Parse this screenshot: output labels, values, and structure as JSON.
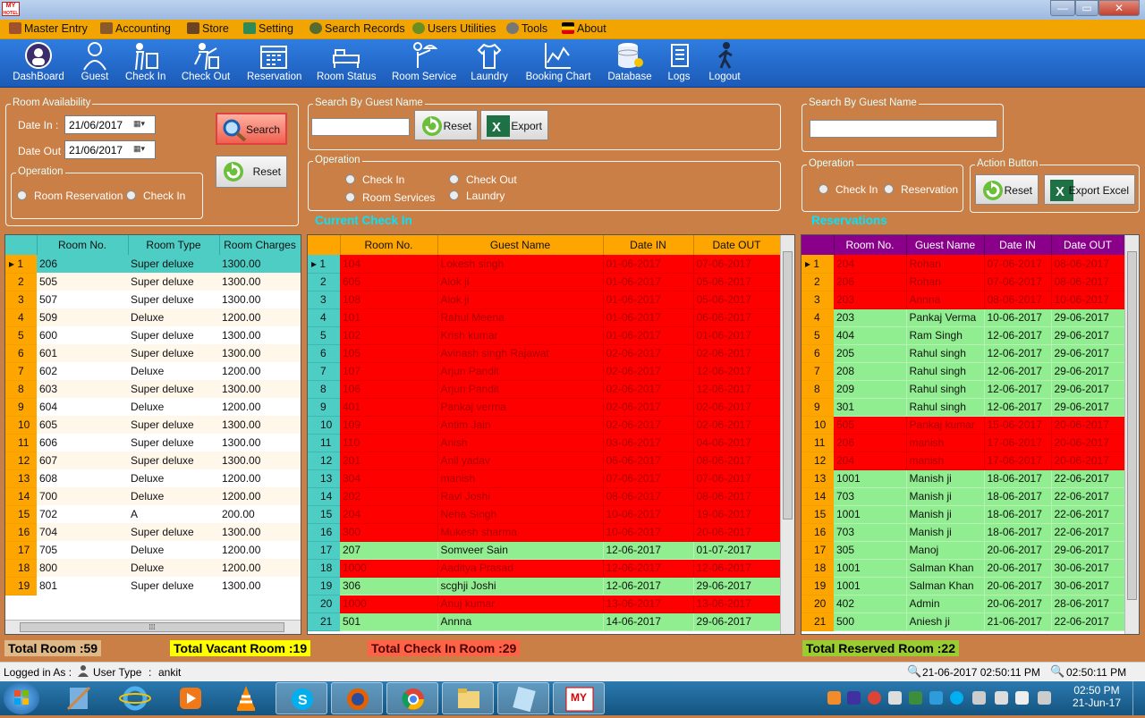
{
  "window": {
    "min": "—",
    "max": "▭",
    "close": "✕"
  },
  "appicon": {
    "line1": "MY",
    "line2": "HOTEL"
  },
  "menu": [
    "Master Entry",
    "Accounting",
    "Store",
    "Setting",
    "Search Records",
    "Users Utilities",
    "Tools",
    "About"
  ],
  "toolbar": [
    "DashBoard",
    "Guest",
    "Check In",
    "Check Out",
    "Reservation",
    "Room Status",
    "Room Service",
    "Laundry",
    "Booking Chart",
    "Database",
    "Logs",
    "Logout"
  ],
  "availability": {
    "legend": "Room Availability",
    "date_in_label": "Date In :",
    "date_in": "21/06/2017",
    "date_out_label": "Date Out :",
    "date_out": "21/06/2017",
    "operation_legend": "Operation",
    "radio1": "Room Reservation",
    "radio2": "Check In",
    "search_btn": "Search",
    "reset_btn": "Reset"
  },
  "checkin_search": {
    "legend": "Search By Guest Name",
    "reset_btn": "Reset",
    "export_btn": "Export",
    "operation_legend": "Operation",
    "radio1": "Check In",
    "radio2": "Check Out",
    "radio3": "Room Services",
    "radio4": "Laundry",
    "section": "Current Check In"
  },
  "reservation_search": {
    "legend": "Search By Guest Name",
    "operation_legend": "Operation",
    "radio1": "Check In",
    "radio2": "Reservation",
    "action_legend": "Action Button",
    "reset_btn": "Reset",
    "export_btn": "Export Excel",
    "section": "Reservations"
  },
  "rooms": {
    "headers": [
      "",
      "Room No.",
      "Room Type",
      "Room Charges"
    ],
    "rows": [
      [
        "1",
        "206",
        "Super deluxe",
        "1300.00"
      ],
      [
        "2",
        "505",
        "Super deluxe",
        "1300.00"
      ],
      [
        "3",
        "507",
        "Super deluxe",
        "1300.00"
      ],
      [
        "4",
        "509",
        "Deluxe",
        "1200.00"
      ],
      [
        "5",
        "600",
        "Super deluxe",
        "1300.00"
      ],
      [
        "6",
        "601",
        "Super deluxe",
        "1300.00"
      ],
      [
        "7",
        "602",
        "Deluxe",
        "1200.00"
      ],
      [
        "8",
        "603",
        "Super deluxe",
        "1300.00"
      ],
      [
        "9",
        "604",
        "Deluxe",
        "1200.00"
      ],
      [
        "10",
        "605",
        "Super deluxe",
        "1300.00"
      ],
      [
        "11",
        "606",
        "Super deluxe",
        "1300.00"
      ],
      [
        "12",
        "607",
        "Super deluxe",
        "1300.00"
      ],
      [
        "13",
        "608",
        "Deluxe",
        "1200.00"
      ],
      [
        "14",
        "700",
        "Deluxe",
        "1200.00"
      ],
      [
        "15",
        "702",
        "A",
        "200.00"
      ],
      [
        "16",
        "704",
        "Super deluxe",
        "1300.00"
      ],
      [
        "17",
        "705",
        "Deluxe",
        "1200.00"
      ],
      [
        "18",
        "800",
        "Deluxe",
        "1200.00"
      ],
      [
        "19",
        "801",
        "Super deluxe",
        "1300.00"
      ]
    ]
  },
  "checkins": {
    "headers": [
      "",
      "Room No.",
      "Guest Name",
      "Date IN",
      "Date OUT"
    ],
    "rows": [
      [
        "1",
        "104",
        "Lokesh singh",
        "01-06-2017",
        "07-06-2017",
        "r"
      ],
      [
        "2",
        "605",
        "Alok ji",
        "01-06-2017",
        "05-06-2017",
        "r"
      ],
      [
        "3",
        "108",
        "Alok ji",
        "01-06-2017",
        "05-06-2017",
        "r"
      ],
      [
        "4",
        "101",
        "Rahul Meena",
        "01-06-2017",
        "06-06-2017",
        "r"
      ],
      [
        "5",
        "102",
        "Krish kumar",
        "01-06-2017",
        "01-06-2017",
        "r"
      ],
      [
        "6",
        "105",
        "Avinash singh Rajawat",
        "02-06-2017",
        "02-06-2017",
        "r"
      ],
      [
        "7",
        "107",
        "Arjun Pandit",
        "02-06-2017",
        "12-06-2017",
        "r"
      ],
      [
        "8",
        "106",
        "Arjun Pandit",
        "02-06-2017",
        "12-06-2017",
        "r"
      ],
      [
        "9",
        "401",
        "Pankaj verma",
        "02-06-2017",
        "02-06-2017",
        "r"
      ],
      [
        "10",
        "109",
        "Antim Jain",
        "02-06-2017",
        "02-06-2017",
        "r"
      ],
      [
        "11",
        "110",
        "Anish",
        "03-06-2017",
        "04-06-2017",
        "r"
      ],
      [
        "12",
        "201",
        "Anil yadav",
        "06-06-2017",
        "08-06-2017",
        "r"
      ],
      [
        "13",
        "304",
        "manish",
        "07-06-2017",
        "07-06-2017",
        "r"
      ],
      [
        "14",
        "202",
        "Ravi Joshi",
        "08-06-2017",
        "08-06-2017",
        "r"
      ],
      [
        "15",
        "204",
        "Neha Singh",
        "10-06-2017",
        "19-06-2017",
        "r"
      ],
      [
        "16",
        "300",
        "Mukesh sharma",
        "10-06-2017",
        "20-06-2017",
        "r"
      ],
      [
        "17",
        "207",
        "Somveer Sain",
        "12-06-2017",
        "01-07-2017",
        "g"
      ],
      [
        "18",
        "1000",
        "Aaditya Prasad",
        "12-06-2017",
        "12-06-2017",
        "r"
      ],
      [
        "19",
        "306",
        "scghji Joshi",
        "12-06-2017",
        "29-06-2017",
        "g"
      ],
      [
        "20",
        "1000",
        "Anuj kumar",
        "13-06-2017",
        "13-06-2017",
        "r"
      ],
      [
        "21",
        "501",
        "Annna",
        "14-06-2017",
        "29-06-2017",
        "g"
      ]
    ]
  },
  "reservations": {
    "headers": [
      "",
      "Room No.",
      "Guest Name",
      "Date IN",
      "Date OUT"
    ],
    "rows": [
      [
        "1",
        "204",
        "Rohan",
        "07-06-2017",
        "08-06-2017",
        "r"
      ],
      [
        "2",
        "206",
        "Rohan",
        "07-06-2017",
        "08-06-2017",
        "r"
      ],
      [
        "3",
        "203",
        "Annna",
        "08-06-2017",
        "10-06-2017",
        "r"
      ],
      [
        "4",
        "203",
        "Pankaj Verma",
        "10-06-2017",
        "29-06-2017",
        "g"
      ],
      [
        "5",
        "404",
        "Ram Singh",
        "12-06-2017",
        "29-06-2017",
        "g"
      ],
      [
        "6",
        "205",
        "Rahul singh",
        "12-06-2017",
        "29-06-2017",
        "g"
      ],
      [
        "7",
        "208",
        "Rahul singh",
        "12-06-2017",
        "29-06-2017",
        "g"
      ],
      [
        "8",
        "209",
        "Rahul singh",
        "12-06-2017",
        "29-06-2017",
        "g"
      ],
      [
        "9",
        "301",
        "Rahul singh",
        "12-06-2017",
        "29-06-2017",
        "g"
      ],
      [
        "10",
        "505",
        "Pankaj kumar",
        "15-06-2017",
        "20-06-2017",
        "r"
      ],
      [
        "11",
        "206",
        "manish",
        "17-06-2017",
        "20-06-2017",
        "r"
      ],
      [
        "12",
        "204",
        "manish",
        "17-06-2017",
        "20-06-2017",
        "r"
      ],
      [
        "13",
        "1001",
        "Manish ji",
        "18-06-2017",
        "22-06-2017",
        "g"
      ],
      [
        "14",
        "703",
        "Manish ji",
        "18-06-2017",
        "22-06-2017",
        "g"
      ],
      [
        "15",
        "1001",
        "Manish ji",
        "18-06-2017",
        "22-06-2017",
        "g"
      ],
      [
        "16",
        "703",
        "Manish ji",
        "18-06-2017",
        "22-06-2017",
        "g"
      ],
      [
        "17",
        "305",
        "Manoj",
        "20-06-2017",
        "29-06-2017",
        "g"
      ],
      [
        "18",
        "1001",
        "Salman Khan",
        "20-06-2017",
        "30-06-2017",
        "g"
      ],
      [
        "19",
        "1001",
        "Salman Khan",
        "20-06-2017",
        "30-06-2017",
        "g"
      ],
      [
        "20",
        "402",
        "Admin",
        "20-06-2017",
        "28-06-2017",
        "g"
      ],
      [
        "21",
        "500",
        "Aniesh ji",
        "21-06-2017",
        "22-06-2017",
        "g"
      ]
    ]
  },
  "totals": {
    "rooms": "Total Room :59",
    "vacant": "Total Vacant Room :19",
    "checkin": "Total Check In Room :29",
    "reserved": "Total Reserved Room :22"
  },
  "status": {
    "logged": "Logged in As :",
    "user_type": "User Type",
    "colon": ":",
    "user": "ankit",
    "datetime": "21-06-2017 02:50:11 PM",
    "time": "02:50:11 PM"
  },
  "taskbar": {
    "clock": "02:50 PM",
    "date": "21-Jun-17"
  },
  "colors": {
    "red_row": "#ff0000",
    "red_text": "#a80000",
    "green_row": "#90ee90",
    "teal_header": "#4ecdc4",
    "orange_header": "#ffa500",
    "purple_header": "#8b008b"
  }
}
